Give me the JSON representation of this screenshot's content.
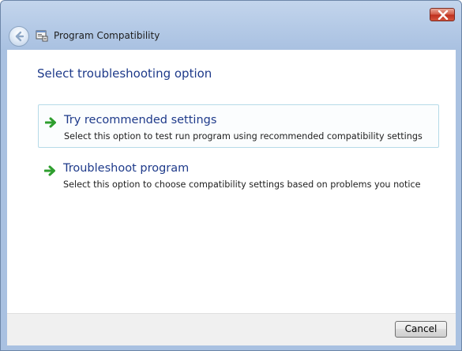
{
  "window": {
    "title": "Program Compatibility"
  },
  "content": {
    "heading": "Select troubleshooting option",
    "options": [
      {
        "title": "Try recommended settings",
        "description": "Select this option to test run program using recommended compatibility settings",
        "icon": "green-arrow-icon"
      },
      {
        "title": "Troubleshoot program",
        "description": "Select this option to choose compatibility settings based on problems you notice",
        "icon": "green-arrow-icon"
      }
    ]
  },
  "footer": {
    "cancel_label": "Cancel"
  },
  "colors": {
    "heading": "#1e3a8a",
    "accent_border": "#b6dbe8",
    "arrow_green": "#2e9e2e",
    "close_red": "#c0311f"
  }
}
